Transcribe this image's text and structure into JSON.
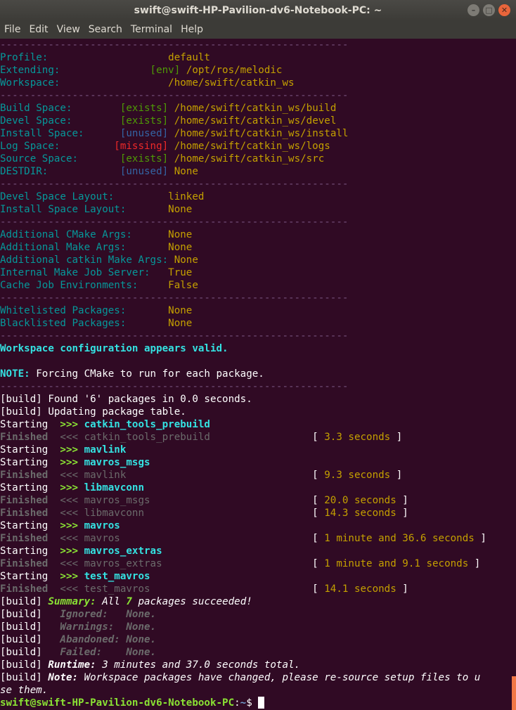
{
  "window": {
    "title": "swift@swift-HP-Pavilion-dv6-Notebook-PC: ~",
    "buttons": [
      "–",
      "□",
      "✕"
    ]
  },
  "menu": [
    "File",
    "Edit",
    "View",
    "Search",
    "Terminal",
    "Help"
  ],
  "colors": {
    "background": "#300a24",
    "separator": "#75507b",
    "label": "#06989a",
    "value": "#c4a000",
    "prompt": "#8ae234",
    "scroll_thumb": "#f07746"
  },
  "lines": [
    [
      [
        "c-sep",
        "----------------------------------------------------------"
      ]
    ],
    [
      [
        "c-cyan",
        "Profile:                    "
      ],
      [
        "c-yellow",
        "default"
      ]
    ],
    [
      [
        "c-cyan",
        "Extending:               "
      ],
      [
        "c-green",
        "[env]"
      ],
      [
        "c-white",
        " "
      ],
      [
        "c-yellow",
        "/opt/ros/melodic"
      ]
    ],
    [
      [
        "c-cyan",
        "Workspace:                  "
      ],
      [
        "c-yellow",
        "/home/swift/catkin_ws"
      ]
    ],
    [
      [
        "c-sep",
        "----------------------------------------------------------"
      ]
    ],
    [
      [
        "c-cyan",
        "Build Space:        "
      ],
      [
        "c-green",
        "[exists]"
      ],
      [
        "c-white",
        " "
      ],
      [
        "c-yellow",
        "/home/swift/catkin_ws/build"
      ]
    ],
    [
      [
        "c-cyan",
        "Devel Space:        "
      ],
      [
        "c-green",
        "[exists]"
      ],
      [
        "c-white",
        " "
      ],
      [
        "c-yellow",
        "/home/swift/catkin_ws/devel"
      ]
    ],
    [
      [
        "c-cyan",
        "Install Space:      "
      ],
      [
        "c-blue",
        "[unused]"
      ],
      [
        "c-white",
        " "
      ],
      [
        "c-yellow",
        "/home/swift/catkin_ws/install"
      ]
    ],
    [
      [
        "c-cyan",
        "Log Space:         "
      ],
      [
        "c-red",
        "[missing]"
      ],
      [
        "c-white",
        " "
      ],
      [
        "c-yellow",
        "/home/swift/catkin_ws/logs"
      ]
    ],
    [
      [
        "c-cyan",
        "Source Space:       "
      ],
      [
        "c-green",
        "[exists]"
      ],
      [
        "c-white",
        " "
      ],
      [
        "c-yellow",
        "/home/swift/catkin_ws/src"
      ]
    ],
    [
      [
        "c-cyan",
        "DESTDIR:            "
      ],
      [
        "c-blue",
        "[unused]"
      ],
      [
        "c-white",
        " "
      ],
      [
        "c-yellow",
        "None"
      ]
    ],
    [
      [
        "c-sep",
        "----------------------------------------------------------"
      ]
    ],
    [
      [
        "c-cyan",
        "Devel Space Layout:         "
      ],
      [
        "c-yellow",
        "linked"
      ]
    ],
    [
      [
        "c-cyan",
        "Install Space Layout:       "
      ],
      [
        "c-yellow",
        "None"
      ]
    ],
    [
      [
        "c-sep",
        "----------------------------------------------------------"
      ]
    ],
    [
      [
        "c-cyan",
        "Additional CMake Args:      "
      ],
      [
        "c-yellow",
        "None"
      ]
    ],
    [
      [
        "c-cyan",
        "Additional Make Args:       "
      ],
      [
        "c-yellow",
        "None"
      ]
    ],
    [
      [
        "c-cyan",
        "Additional catkin Make Args: "
      ],
      [
        "c-yellow",
        "None"
      ]
    ],
    [
      [
        "c-cyan",
        "Internal Make Job Server:   "
      ],
      [
        "c-yellow",
        "True"
      ]
    ],
    [
      [
        "c-cyan",
        "Cache Job Environments:     "
      ],
      [
        "c-yellow",
        "False"
      ]
    ],
    [
      [
        "c-sep",
        "----------------------------------------------------------"
      ]
    ],
    [
      [
        "c-cyan",
        "Whitelisted Packages:       "
      ],
      [
        "c-yellow",
        "None"
      ]
    ],
    [
      [
        "c-cyan",
        "Blacklisted Packages:       "
      ],
      [
        "c-yellow",
        "None"
      ]
    ],
    [
      [
        "c-sep",
        "----------------------------------------------------------"
      ]
    ],
    [
      [
        "c-bcyan",
        "Workspace configuration appears valid."
      ]
    ],
    [
      [
        "c-white",
        ""
      ]
    ],
    [
      [
        "c-bcyan",
        "NOTE:"
      ],
      [
        "c-white",
        " Forcing CMake to run for each package."
      ]
    ],
    [
      [
        "c-sep",
        "----------------------------------------------------------"
      ]
    ],
    [
      [
        "c-white",
        "[build] Found '6' packages in 0.0 seconds."
      ]
    ],
    [
      [
        "c-white",
        "[build] Updating package table."
      ]
    ],
    [
      [
        "c-white",
        "Starting  "
      ],
      [
        "c-bgreen",
        ">>> "
      ],
      [
        "c-bcyan",
        "catkin_tools_prebuild"
      ]
    ],
    [
      [
        "c-gray",
        "Finished  "
      ],
      [
        "c-dgray",
        "<<< catkin_tools_prebuild                 "
      ],
      [
        "c-white",
        "[ "
      ],
      [
        "c-yellow",
        "3.3 seconds"
      ],
      [
        "c-white",
        " ]"
      ]
    ],
    [
      [
        "c-white",
        "Starting  "
      ],
      [
        "c-bgreen",
        ">>> "
      ],
      [
        "c-bcyan",
        "mavlink"
      ]
    ],
    [
      [
        "c-white",
        "Starting  "
      ],
      [
        "c-bgreen",
        ">>> "
      ],
      [
        "c-bcyan",
        "mavros_msgs"
      ]
    ],
    [
      [
        "c-gray",
        "Finished  "
      ],
      [
        "c-dgray",
        "<<< mavlink                               "
      ],
      [
        "c-white",
        "[ "
      ],
      [
        "c-yellow",
        "9.3 seconds"
      ],
      [
        "c-white",
        " ]"
      ]
    ],
    [
      [
        "c-white",
        "Starting  "
      ],
      [
        "c-bgreen",
        ">>> "
      ],
      [
        "c-bcyan",
        "libmavconn"
      ]
    ],
    [
      [
        "c-gray",
        "Finished  "
      ],
      [
        "c-dgray",
        "<<< mavros_msgs                           "
      ],
      [
        "c-white",
        "[ "
      ],
      [
        "c-yellow",
        "20.0 seconds"
      ],
      [
        "c-white",
        " ]"
      ]
    ],
    [
      [
        "c-gray",
        "Finished  "
      ],
      [
        "c-dgray",
        "<<< libmavconn                            "
      ],
      [
        "c-white",
        "[ "
      ],
      [
        "c-yellow",
        "14.3 seconds"
      ],
      [
        "c-white",
        " ]"
      ]
    ],
    [
      [
        "c-white",
        "Starting  "
      ],
      [
        "c-bgreen",
        ">>> "
      ],
      [
        "c-bcyan",
        "mavros"
      ]
    ],
    [
      [
        "c-gray",
        "Finished  "
      ],
      [
        "c-dgray",
        "<<< mavros                                "
      ],
      [
        "c-white",
        "[ "
      ],
      [
        "c-yellow",
        "1 minute and 36.6 seconds"
      ],
      [
        "c-white",
        " ]"
      ]
    ],
    [
      [
        "c-white",
        "Starting  "
      ],
      [
        "c-bgreen",
        ">>> "
      ],
      [
        "c-bcyan",
        "mavros_extras"
      ]
    ],
    [
      [
        "c-gray",
        "Finished  "
      ],
      [
        "c-dgray",
        "<<< mavros_extras                         "
      ],
      [
        "c-white",
        "[ "
      ],
      [
        "c-yellow",
        "1 minute and 9.1 seconds"
      ],
      [
        "c-white",
        " ]"
      ]
    ],
    [
      [
        "c-white",
        "Starting  "
      ],
      [
        "c-bgreen",
        ">>> "
      ],
      [
        "c-bcyan",
        "test_mavros"
      ]
    ],
    [
      [
        "c-gray",
        "Finished  "
      ],
      [
        "c-dgray",
        "<<< test_mavros                           "
      ],
      [
        "c-white",
        "[ "
      ],
      [
        "c-yellow",
        "14.1 seconds"
      ],
      [
        "c-white",
        " ]"
      ]
    ],
    [
      [
        "c-white",
        "[build] "
      ],
      [
        "c-bgreen c-ital",
        "Summary:"
      ],
      [
        "c-white c-ital",
        " All "
      ],
      [
        "c-bgreen c-ital",
        "7"
      ],
      [
        "c-white c-ital",
        " packages succeeded!"
      ]
    ],
    [
      [
        "c-white",
        "[build]   "
      ],
      [
        "c-gray c-ital",
        "Ignored:   None."
      ]
    ],
    [
      [
        "c-white",
        "[build]   "
      ],
      [
        "c-gray c-ital",
        "Warnings:  None."
      ]
    ],
    [
      [
        "c-white",
        "[build]   "
      ],
      [
        "c-gray c-ital",
        "Abandoned: None."
      ]
    ],
    [
      [
        "c-white",
        "[build]   "
      ],
      [
        "c-gray c-ital",
        "Failed:    None."
      ]
    ],
    [
      [
        "c-white",
        "[build] "
      ],
      [
        "c-bwhite c-ital",
        "Runtime:"
      ],
      [
        "c-white c-ital",
        " 3 minutes and 37.0 seconds total."
      ]
    ],
    [
      [
        "c-white",
        "[build] "
      ],
      [
        "c-bwhite c-ital",
        "Note:"
      ],
      [
        "c-white c-ital",
        " Workspace packages have changed, please re-source setup files to u"
      ]
    ],
    [
      [
        "c-white c-ital",
        "se them."
      ]
    ]
  ],
  "prompt": {
    "user_host": "swift@swift-HP-Pavilion-dv6-Notebook-PC",
    "colon": ":",
    "path": "~",
    "symbol": "$ "
  }
}
